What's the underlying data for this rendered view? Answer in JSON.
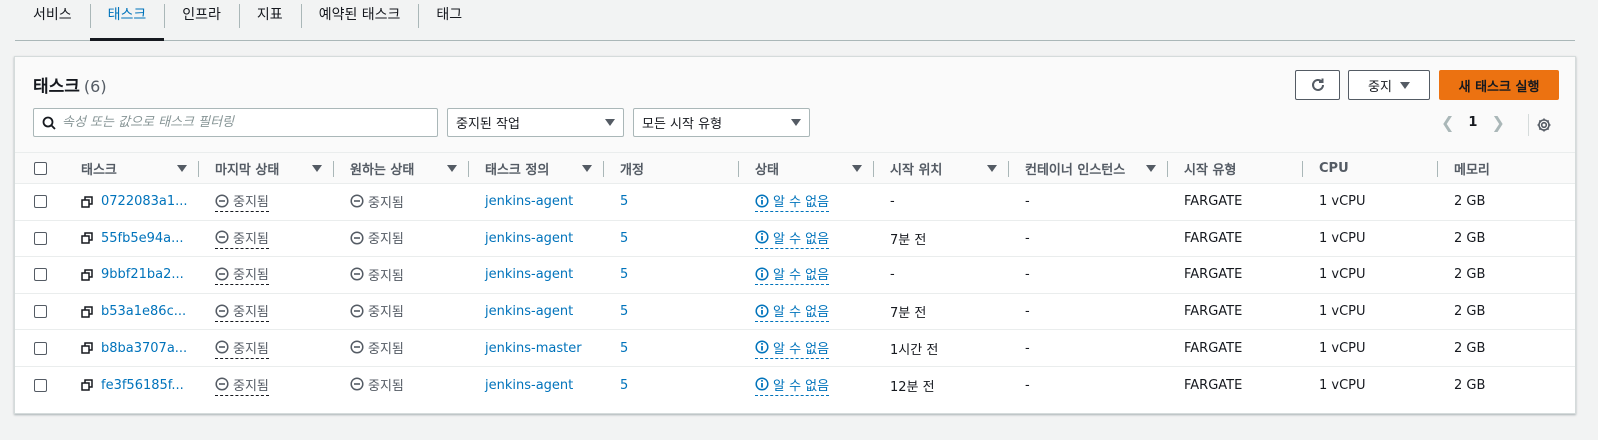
{
  "tabs": [
    {
      "label": "서비스"
    },
    {
      "label": "태스크"
    },
    {
      "label": "인프라"
    },
    {
      "label": "지표"
    },
    {
      "label": "예약된 태스크"
    },
    {
      "label": "태그"
    }
  ],
  "active_tab": "태스크",
  "panel": {
    "title": "태스크",
    "count": "(6)",
    "stop_button": "중지",
    "new_task_button": "새 태스크 실행",
    "search_placeholder": "속성 또는 값으로 태스크 필터링",
    "status_filter": "중지된 작업",
    "launch_filter": "모든 시작 유형",
    "page": "1"
  },
  "columns": [
    "태스크",
    "마지막 상태",
    "원하는 상태",
    "태스크 정의",
    "개정",
    "상태",
    "시작 위치",
    "컨테이너 인스턴스",
    "시작 유형",
    "CPU",
    "메모리"
  ],
  "rows": [
    {
      "task": "0722083a1...",
      "last_status": "중지됨",
      "desired_status": "중지됨",
      "definition": "jenkins-agent",
      "revision": "5",
      "health": "알 수 없음",
      "started": "-",
      "container": "-",
      "launch_type": "FARGATE",
      "cpu": "1 vCPU",
      "memory": "2 GB"
    },
    {
      "task": "55fb5e94a...",
      "last_status": "중지됨",
      "desired_status": "중지됨",
      "definition": "jenkins-agent",
      "revision": "5",
      "health": "알 수 없음",
      "started": "7분 전",
      "container": "-",
      "launch_type": "FARGATE",
      "cpu": "1 vCPU",
      "memory": "2 GB"
    },
    {
      "task": "9bbf21ba2...",
      "last_status": "중지됨",
      "desired_status": "중지됨",
      "definition": "jenkins-agent",
      "revision": "5",
      "health": "알 수 없음",
      "started": "-",
      "container": "-",
      "launch_type": "FARGATE",
      "cpu": "1 vCPU",
      "memory": "2 GB"
    },
    {
      "task": "b53a1e86c...",
      "last_status": "중지됨",
      "desired_status": "중지됨",
      "definition": "jenkins-agent",
      "revision": "5",
      "health": "알 수 없음",
      "started": "7분 전",
      "container": "-",
      "launch_type": "FARGATE",
      "cpu": "1 vCPU",
      "memory": "2 GB"
    },
    {
      "task": "b8ba3707a...",
      "last_status": "중지됨",
      "desired_status": "중지됨",
      "definition": "jenkins-master",
      "revision": "5",
      "health": "알 수 없음",
      "started": "1시간 전",
      "container": "-",
      "launch_type": "FARGATE",
      "cpu": "1 vCPU",
      "memory": "2 GB"
    },
    {
      "task": "fe3f56185f...",
      "last_status": "중지됨",
      "desired_status": "중지됨",
      "definition": "jenkins-agent",
      "revision": "5",
      "health": "알 수 없음",
      "started": "12분 전",
      "container": "-",
      "launch_type": "FARGATE",
      "cpu": "1 vCPU",
      "memory": "2 GB"
    }
  ],
  "icons": {
    "refresh": "refresh-icon",
    "search": "search-icon",
    "settings": "gear-icon",
    "external": "popout-icon",
    "stopped": "stopped-circle-icon",
    "info": "info-icon"
  },
  "colors": {
    "accent": "#0073bb",
    "primary_button": "#ec7211"
  }
}
